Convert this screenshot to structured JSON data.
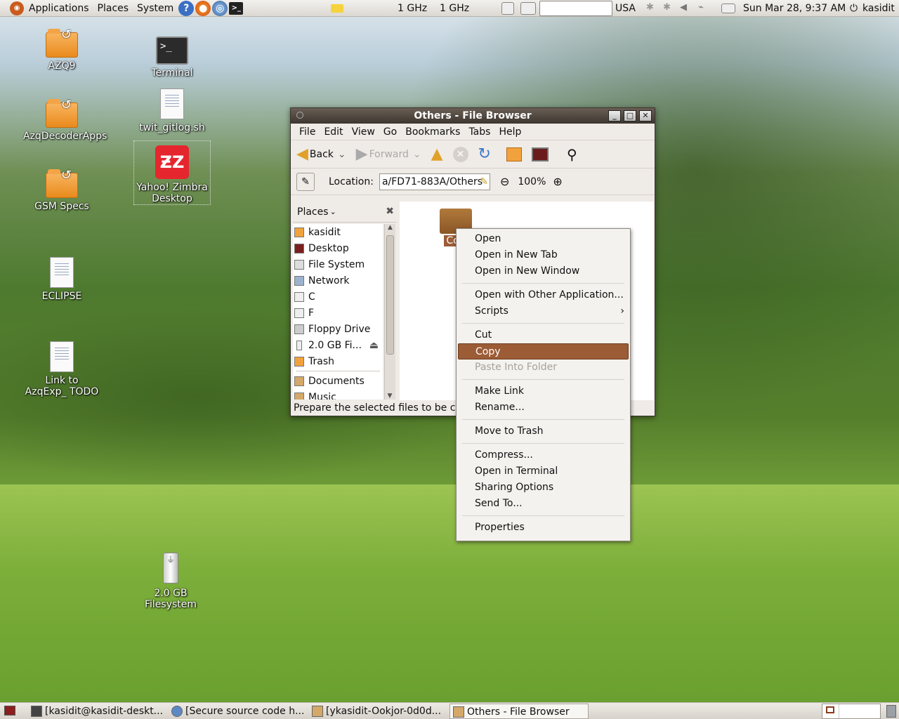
{
  "top_panel": {
    "menus": [
      "Applications",
      "Places",
      "System"
    ],
    "cpu1": "1 GHz",
    "cpu2": "1 GHz",
    "keyboard_layout": "USA",
    "datetime": "Sun Mar 28,  9:37 AM",
    "user": "kasidit"
  },
  "desktop_icons": [
    {
      "label": "AZQ9"
    },
    {
      "label": "AzqDecoderApps"
    },
    {
      "label": "GSM Specs"
    },
    {
      "label": "ECLIPSE"
    },
    {
      "label": "Link to AzqExp_ TODO"
    },
    {
      "label": "Terminal"
    },
    {
      "label": "twit_gitlog.sh"
    },
    {
      "label": "Yahoo! Zimbra Desktop"
    },
    {
      "label": "2.0 GB Filesystem"
    }
  ],
  "window": {
    "title": "Others - File Browser",
    "menus": [
      "File",
      "Edit",
      "View",
      "Go",
      "Bookmarks",
      "Tabs",
      "Help"
    ],
    "toolbar": {
      "back": "Back",
      "forward": "Forward"
    },
    "location_label": "Location:",
    "location_value": "a/FD71-883A/Others",
    "zoom": "100%",
    "sidebar_title": "Places",
    "places": [
      "kasidit",
      "Desktop",
      "File System",
      "Network",
      "C",
      "F",
      "Floppy Drive",
      "2.0 GB Fi...",
      "Trash",
      "Documents",
      "Music"
    ],
    "folder_label": "Con",
    "status": "Prepare the selected files to be copied"
  },
  "context_menu": {
    "groups": [
      [
        "Open",
        "Open in New Tab",
        "Open in New Window"
      ],
      [
        "Open with Other Application...",
        "Scripts"
      ],
      [
        "Cut",
        "Copy",
        "Paste Into Folder"
      ],
      [
        "Make Link",
        "Rename..."
      ],
      [
        "Move to Trash"
      ],
      [
        "Compress...",
        "Open in Terminal",
        "Sharing Options",
        "Send To..."
      ],
      [
        "Properties"
      ]
    ],
    "highlighted": "Copy",
    "disabled": "Paste Into Folder"
  },
  "taskbar": [
    {
      "label": "[kasidit@kasidit-deskt..."
    },
    {
      "label": "[Secure source code h..."
    },
    {
      "label": "[ykasidit-Ookjor-0d0d..."
    },
    {
      "label": "Others - File Browser"
    }
  ],
  "colors": {
    "accent": "#9b5c36",
    "panel": "#e8e4df"
  }
}
